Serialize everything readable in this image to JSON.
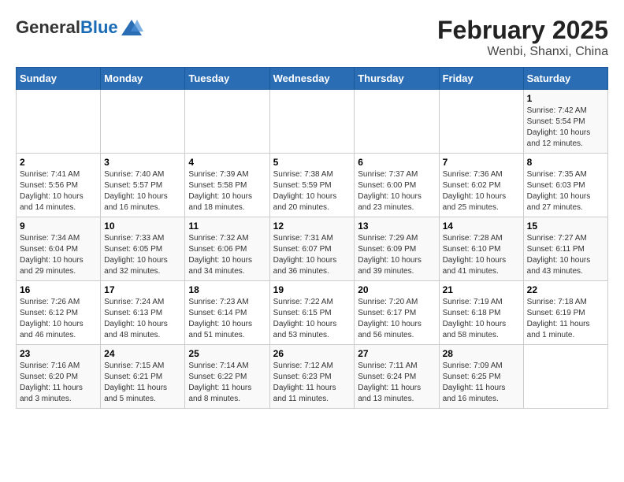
{
  "logo": {
    "general": "General",
    "blue": "Blue"
  },
  "title": "February 2025",
  "subtitle": "Wenbi, Shanxi, China",
  "days_of_week": [
    "Sunday",
    "Monday",
    "Tuesday",
    "Wednesday",
    "Thursday",
    "Friday",
    "Saturday"
  ],
  "weeks": [
    [
      {
        "day": "",
        "info": ""
      },
      {
        "day": "",
        "info": ""
      },
      {
        "day": "",
        "info": ""
      },
      {
        "day": "",
        "info": ""
      },
      {
        "day": "",
        "info": ""
      },
      {
        "day": "",
        "info": ""
      },
      {
        "day": "1",
        "info": "Sunrise: 7:42 AM\nSunset: 5:54 PM\nDaylight: 10 hours and 12 minutes."
      }
    ],
    [
      {
        "day": "2",
        "info": "Sunrise: 7:41 AM\nSunset: 5:56 PM\nDaylight: 10 hours and 14 minutes."
      },
      {
        "day": "3",
        "info": "Sunrise: 7:40 AM\nSunset: 5:57 PM\nDaylight: 10 hours and 16 minutes."
      },
      {
        "day": "4",
        "info": "Sunrise: 7:39 AM\nSunset: 5:58 PM\nDaylight: 10 hours and 18 minutes."
      },
      {
        "day": "5",
        "info": "Sunrise: 7:38 AM\nSunset: 5:59 PM\nDaylight: 10 hours and 20 minutes."
      },
      {
        "day": "6",
        "info": "Sunrise: 7:37 AM\nSunset: 6:00 PM\nDaylight: 10 hours and 23 minutes."
      },
      {
        "day": "7",
        "info": "Sunrise: 7:36 AM\nSunset: 6:02 PM\nDaylight: 10 hours and 25 minutes."
      },
      {
        "day": "8",
        "info": "Sunrise: 7:35 AM\nSunset: 6:03 PM\nDaylight: 10 hours and 27 minutes."
      }
    ],
    [
      {
        "day": "9",
        "info": "Sunrise: 7:34 AM\nSunset: 6:04 PM\nDaylight: 10 hours and 29 minutes."
      },
      {
        "day": "10",
        "info": "Sunrise: 7:33 AM\nSunset: 6:05 PM\nDaylight: 10 hours and 32 minutes."
      },
      {
        "day": "11",
        "info": "Sunrise: 7:32 AM\nSunset: 6:06 PM\nDaylight: 10 hours and 34 minutes."
      },
      {
        "day": "12",
        "info": "Sunrise: 7:31 AM\nSunset: 6:07 PM\nDaylight: 10 hours and 36 minutes."
      },
      {
        "day": "13",
        "info": "Sunrise: 7:29 AM\nSunset: 6:09 PM\nDaylight: 10 hours and 39 minutes."
      },
      {
        "day": "14",
        "info": "Sunrise: 7:28 AM\nSunset: 6:10 PM\nDaylight: 10 hours and 41 minutes."
      },
      {
        "day": "15",
        "info": "Sunrise: 7:27 AM\nSunset: 6:11 PM\nDaylight: 10 hours and 43 minutes."
      }
    ],
    [
      {
        "day": "16",
        "info": "Sunrise: 7:26 AM\nSunset: 6:12 PM\nDaylight: 10 hours and 46 minutes."
      },
      {
        "day": "17",
        "info": "Sunrise: 7:24 AM\nSunset: 6:13 PM\nDaylight: 10 hours and 48 minutes."
      },
      {
        "day": "18",
        "info": "Sunrise: 7:23 AM\nSunset: 6:14 PM\nDaylight: 10 hours and 51 minutes."
      },
      {
        "day": "19",
        "info": "Sunrise: 7:22 AM\nSunset: 6:15 PM\nDaylight: 10 hours and 53 minutes."
      },
      {
        "day": "20",
        "info": "Sunrise: 7:20 AM\nSunset: 6:17 PM\nDaylight: 10 hours and 56 minutes."
      },
      {
        "day": "21",
        "info": "Sunrise: 7:19 AM\nSunset: 6:18 PM\nDaylight: 10 hours and 58 minutes."
      },
      {
        "day": "22",
        "info": "Sunrise: 7:18 AM\nSunset: 6:19 PM\nDaylight: 11 hours and 1 minute."
      }
    ],
    [
      {
        "day": "23",
        "info": "Sunrise: 7:16 AM\nSunset: 6:20 PM\nDaylight: 11 hours and 3 minutes."
      },
      {
        "day": "24",
        "info": "Sunrise: 7:15 AM\nSunset: 6:21 PM\nDaylight: 11 hours and 5 minutes."
      },
      {
        "day": "25",
        "info": "Sunrise: 7:14 AM\nSunset: 6:22 PM\nDaylight: 11 hours and 8 minutes."
      },
      {
        "day": "26",
        "info": "Sunrise: 7:12 AM\nSunset: 6:23 PM\nDaylight: 11 hours and 11 minutes."
      },
      {
        "day": "27",
        "info": "Sunrise: 7:11 AM\nSunset: 6:24 PM\nDaylight: 11 hours and 13 minutes."
      },
      {
        "day": "28",
        "info": "Sunrise: 7:09 AM\nSunset: 6:25 PM\nDaylight: 11 hours and 16 minutes."
      },
      {
        "day": "",
        "info": ""
      }
    ]
  ]
}
